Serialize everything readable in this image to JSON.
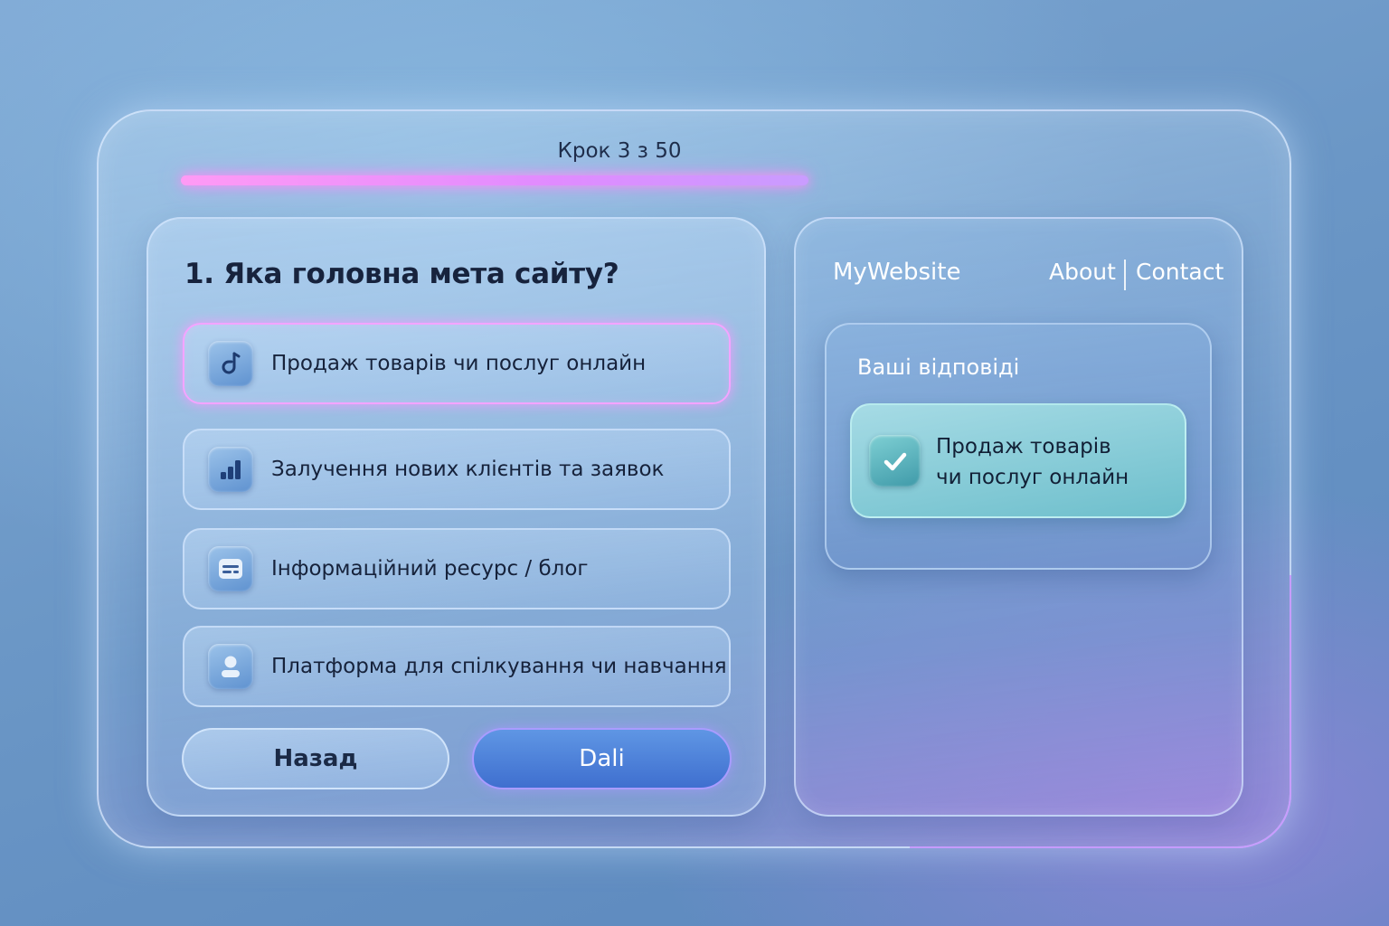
{
  "progress": {
    "step_label": "Крок 3 з 50",
    "current_step": 3,
    "total_steps": 50
  },
  "question": {
    "title": "1. Яка головна мета сайту?",
    "options": [
      {
        "label": "Продаж товарів чи послуг онлайн",
        "icon": "music-note-icon",
        "selected": true
      },
      {
        "label": "Залучення нових клієнтів та заявок",
        "icon": "bar-chart-icon",
        "selected": false
      },
      {
        "label": "Інформаційний ресурс / блог",
        "icon": "document-icon",
        "selected": false
      },
      {
        "label": "Платформа для спілкування чи навчання",
        "icon": "user-icon",
        "selected": false
      }
    ]
  },
  "buttons": {
    "back_label": "Назад",
    "next_label": "Dali"
  },
  "preview": {
    "brand": "MyWebsite",
    "nav": {
      "about": "About",
      "contact": "Contact"
    },
    "answers_title": "Ваші відповіді",
    "answer": {
      "line1": "Продаж товарів",
      "line2": "чи послуг онлайн",
      "icon": "check-icon"
    }
  },
  "colors": {
    "accent_pink": "#f4a4ff",
    "primary_blue": "#3f6fcf",
    "answer_teal": "#6ebfcc"
  }
}
